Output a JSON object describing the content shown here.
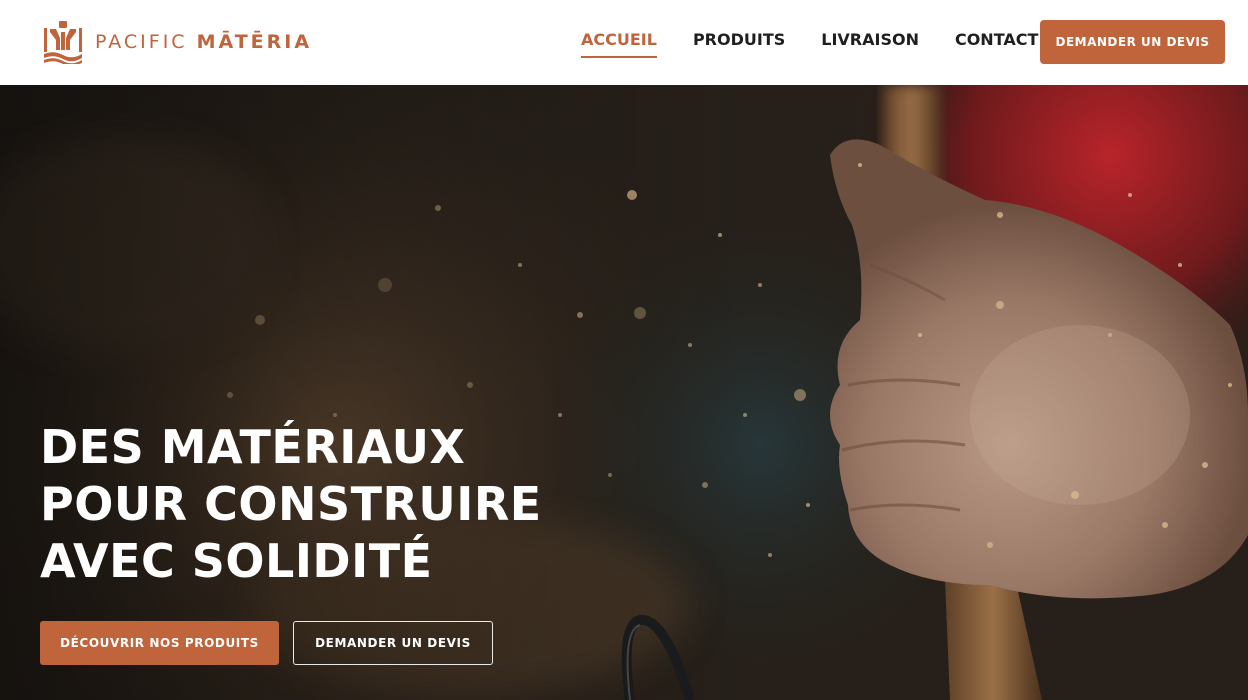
{
  "brand": {
    "name_part1": "PACIFIC",
    "name_part2": "MĀTĒRIA",
    "accent_color": "#c0643c"
  },
  "nav": {
    "items": [
      {
        "label": "ACCUEIL",
        "active": true
      },
      {
        "label": "PRODUITS",
        "active": false
      },
      {
        "label": "LIVRAISON",
        "active": false
      },
      {
        "label": "CONTACT",
        "active": false
      }
    ],
    "cta_label": "DEMANDER UN DEVIS"
  },
  "hero": {
    "title_lines": [
      "DES MATÉRIAUX",
      "POUR CONSTRUIRE",
      "AVEC SOLIDITÉ"
    ],
    "primary_button": "DÉCOUVRIR NOS PRODUITS",
    "secondary_button": "DEMANDER UN DEVIS",
    "image_subject": "hand gripping a wooden tool handle in a cloud of sawdust"
  }
}
